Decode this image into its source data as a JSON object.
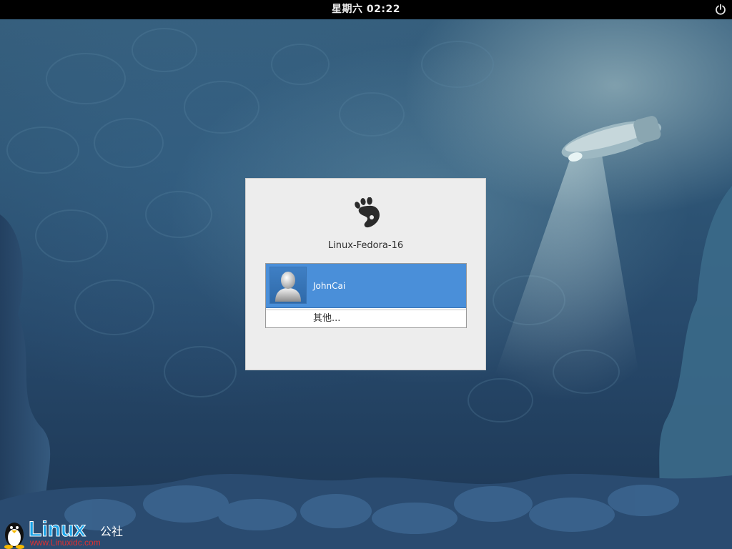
{
  "top_panel": {
    "clock": "星期六 02:22",
    "power_icon": "power-icon"
  },
  "login": {
    "logo_icon": "gnome-foot-icon",
    "host_name": "Linux-Fedora-16",
    "users": [
      {
        "name": "JohnCai",
        "avatar_icon": "user-avatar-icon",
        "selected": true
      }
    ],
    "other_label": "其他..."
  },
  "watermark": {
    "brand": "Linux",
    "brand_suffix": "公社",
    "url": "www.Linuxidc.com"
  },
  "colors": {
    "panel_bg": "#000000",
    "dialog_bg": "#ededed",
    "selection": "#4a8fd9"
  }
}
